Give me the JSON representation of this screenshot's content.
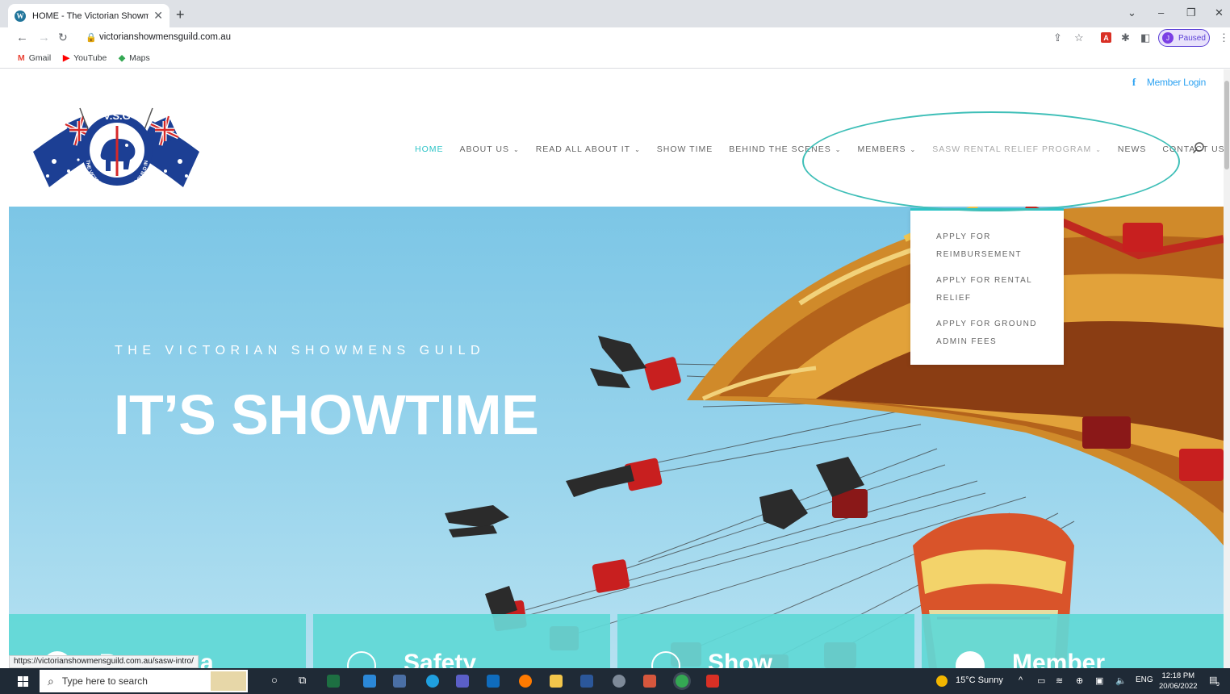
{
  "browser": {
    "tab_title": "HOME - The Victorian Showmen",
    "url": "victorianshowmensguild.com.au",
    "profile_initial": "J",
    "profile_status": "Paused",
    "bookmarks": [
      {
        "label": "Gmail"
      },
      {
        "label": "YouTube"
      },
      {
        "label": "Maps"
      }
    ],
    "status_url": "https://victorianshowmensguild.com.au/sasw-intro/"
  },
  "site": {
    "member_login": "Member Login",
    "logo_text": "V.S.G",
    "logo_ring_text": "THE VICTORIAN SHOWMENS GUILD INC.",
    "nav": [
      {
        "label": "HOME",
        "has_dropdown": false
      },
      {
        "label": "ABOUT US",
        "has_dropdown": true
      },
      {
        "label": "READ ALL ABOUT IT",
        "has_dropdown": true
      },
      {
        "label": "SHOW TIME",
        "has_dropdown": false
      },
      {
        "label": "BEHIND THE SCENES",
        "has_dropdown": true
      },
      {
        "label": "MEMBERS",
        "has_dropdown": true
      },
      {
        "label": "SASW RENTAL RELIEF PROGRAM",
        "has_dropdown": true
      },
      {
        "label": "NEWS",
        "has_dropdown": false
      },
      {
        "label": "CONTACT US",
        "has_dropdown": false
      }
    ],
    "chevron": "⌄",
    "dropdown": [
      {
        "label": "APPLY FOR REIMBURSEMENT"
      },
      {
        "label": "APPLY FOR RENTAL RELIEF"
      },
      {
        "label": "APPLY FOR GROUND ADMIN FEES"
      }
    ],
    "hero": {
      "kicker": "THE VICTORIAN SHOWMENS GUILD",
      "title": "IT’S SHOWTIME"
    },
    "cards": [
      {
        "title": "Become a"
      },
      {
        "title": "Safety"
      },
      {
        "title": "Show"
      },
      {
        "title": "Member"
      }
    ]
  },
  "taskbar": {
    "search_placeholder": "Type here to search",
    "weather": "15°C  Sunny",
    "language": "ENG",
    "time": "12:18 PM",
    "date": "20/06/2022",
    "notification_count": "9"
  },
  "colors": {
    "accent": "#2ec4c7",
    "link": "#2ea3f2",
    "highlight_ring": "#3fbfb8",
    "card_teal": "#60d8d6"
  }
}
